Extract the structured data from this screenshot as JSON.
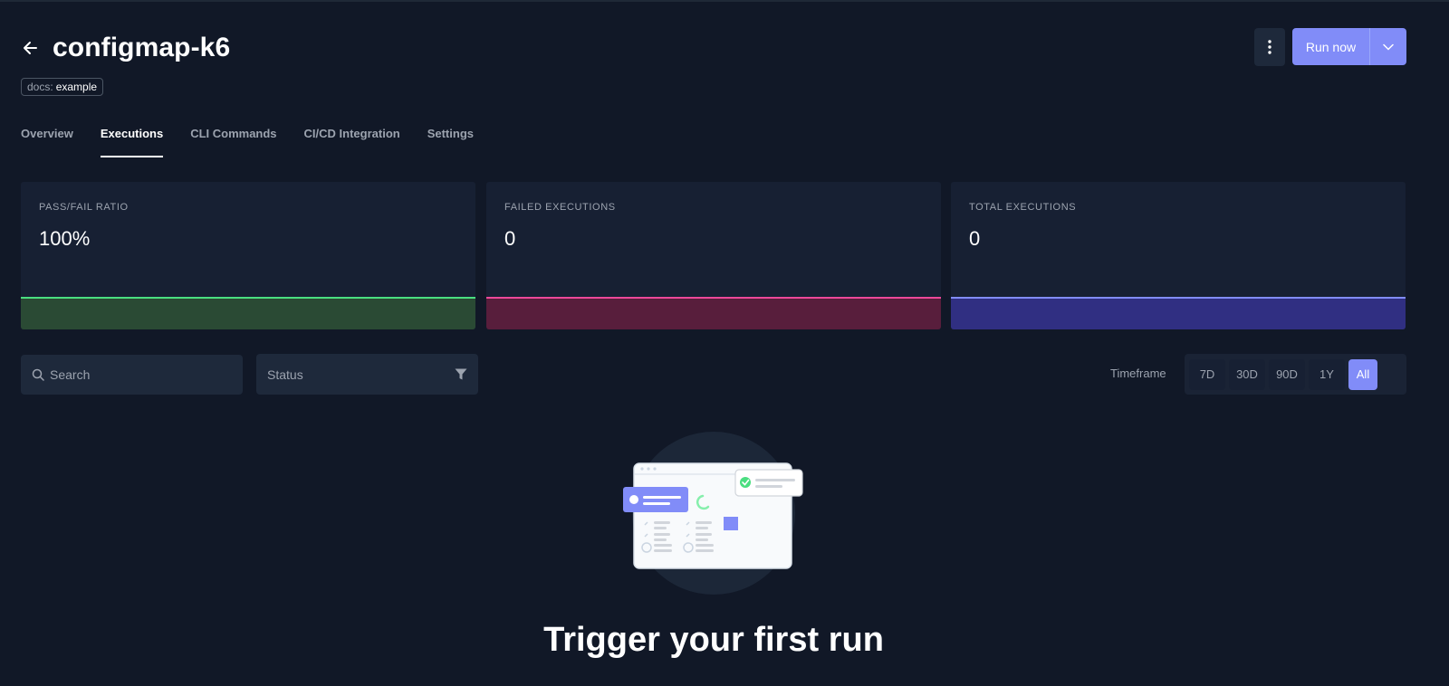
{
  "header": {
    "title": "configmap-k6",
    "label": {
      "key": "docs:",
      "value": "example"
    },
    "run_button": "Run now"
  },
  "tabs": [
    {
      "label": "Overview",
      "active": false
    },
    {
      "label": "Executions",
      "active": true
    },
    {
      "label": "CLI Commands",
      "active": false
    },
    {
      "label": "CI/CD Integration",
      "active": false
    },
    {
      "label": "Settings",
      "active": false
    }
  ],
  "stats": [
    {
      "label": "PASS/FAIL RATIO",
      "value": "100%",
      "color": "#4ade80"
    },
    {
      "label": "FAILED EXECUTIONS",
      "value": "0",
      "color": "#ec4899"
    },
    {
      "label": "TOTAL EXECUTIONS",
      "value": "0",
      "color": "#818cf8"
    }
  ],
  "filters": {
    "search_placeholder": "Search",
    "status_placeholder": "Status",
    "timeframe_label": "Timeframe",
    "timeframes": [
      "7D",
      "30D",
      "90D",
      "1Y",
      "All"
    ],
    "selected_timeframe": "All"
  },
  "empty_state": {
    "title": "Trigger your first run"
  },
  "colors": {
    "accent": "#818cf8",
    "background": "#111827",
    "card": "#172033"
  }
}
